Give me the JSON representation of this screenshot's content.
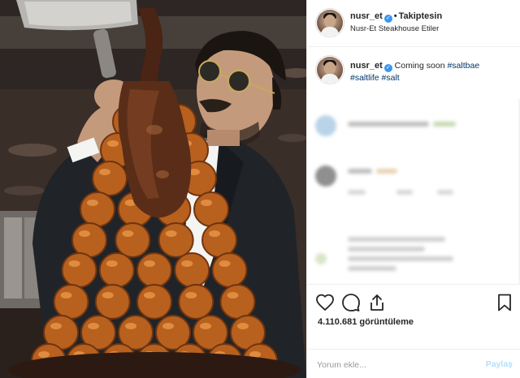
{
  "post": {
    "username": "nusr_et",
    "verified": true,
    "follow_status": "Takiptesin",
    "location": "Nusr-Et Steakhouse Etiler",
    "caption": {
      "username": "nusr_et",
      "text": "Coming soon",
      "hashtags": [
        "#saltbae",
        "#saltlife",
        "#salt"
      ]
    },
    "views": "4.110.681 görüntüleme",
    "comment_placeholder": "Yorum ekle...",
    "post_button": "Paylaş"
  },
  "icons": {
    "like": "heart-icon",
    "comment": "speech-bubble-icon",
    "share": "share-arrow-icon",
    "save": "bookmark-icon",
    "verified": "verified-badge-icon"
  },
  "colors": {
    "link": "#003569",
    "verified": "#3897f0",
    "muted": "#999999",
    "post_button_disabled": "#b2dffc"
  }
}
